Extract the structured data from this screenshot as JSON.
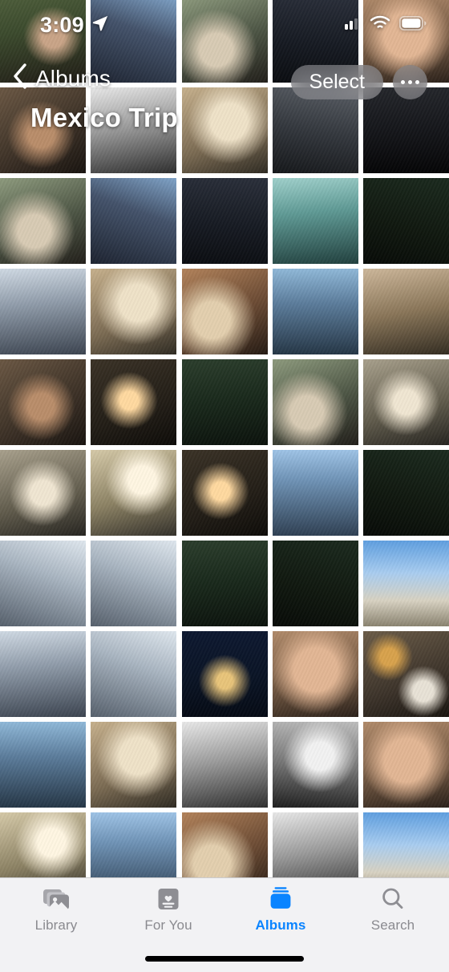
{
  "status_bar": {
    "time": "3:09",
    "location_icon": "location-arrow-icon",
    "cellular_icon": "cellular-signal-icon",
    "wifi_icon": "wifi-icon",
    "battery_icon": "battery-icon"
  },
  "nav": {
    "back_label": "Albums",
    "back_icon": "chevron-left-icon",
    "album_title": "Mexico Trip",
    "select_label": "Select",
    "more_icon": "ellipsis-icon"
  },
  "grid": {
    "columns": 5,
    "photos": [
      {
        "id": "photo-1",
        "style": "a"
      },
      {
        "id": "photo-2",
        "style": "b"
      },
      {
        "id": "photo-3",
        "style": "c"
      },
      {
        "id": "photo-4",
        "style": "d"
      },
      {
        "id": "photo-5",
        "style": "skin"
      },
      {
        "id": "photo-6",
        "style": "g"
      },
      {
        "id": "photo-7",
        "style": "gray"
      },
      {
        "id": "photo-8",
        "style": "e"
      },
      {
        "id": "photo-9",
        "style": "l"
      },
      {
        "id": "photo-10",
        "style": "dark"
      },
      {
        "id": "photo-11",
        "style": "c"
      },
      {
        "id": "photo-12",
        "style": "b"
      },
      {
        "id": "photo-13",
        "style": "d"
      },
      {
        "id": "photo-14",
        "style": "teal"
      },
      {
        "id": "photo-15",
        "style": "h"
      },
      {
        "id": "photo-16",
        "style": "f"
      },
      {
        "id": "photo-17",
        "style": "e"
      },
      {
        "id": "photo-18",
        "style": "k"
      },
      {
        "id": "photo-19",
        "style": "q"
      },
      {
        "id": "photo-20",
        "style": "r"
      },
      {
        "id": "photo-21",
        "style": "g"
      },
      {
        "id": "photo-22",
        "style": "p"
      },
      {
        "id": "photo-23",
        "style": "n"
      },
      {
        "id": "photo-24",
        "style": "c"
      },
      {
        "id": "photo-25",
        "style": "m"
      },
      {
        "id": "photo-26",
        "style": "m"
      },
      {
        "id": "photo-27",
        "style": "i"
      },
      {
        "id": "photo-28",
        "style": "p"
      },
      {
        "id": "photo-29",
        "style": "j"
      },
      {
        "id": "photo-30",
        "style": "h"
      },
      {
        "id": "photo-31",
        "style": "o"
      },
      {
        "id": "photo-32",
        "style": "o"
      },
      {
        "id": "photo-33",
        "style": "n"
      },
      {
        "id": "photo-34",
        "style": "h"
      },
      {
        "id": "photo-35",
        "style": "sky"
      },
      {
        "id": "photo-36",
        "style": "f"
      },
      {
        "id": "photo-37",
        "style": "o"
      },
      {
        "id": "photo-38",
        "style": "night"
      },
      {
        "id": "photo-39",
        "style": "skin"
      },
      {
        "id": "photo-40",
        "style": "food"
      },
      {
        "id": "photo-41",
        "style": "q"
      },
      {
        "id": "photo-42",
        "style": "e"
      },
      {
        "id": "photo-43",
        "style": "gray"
      },
      {
        "id": "photo-44",
        "style": "gray2"
      },
      {
        "id": "photo-45",
        "style": "skin"
      },
      {
        "id": "photo-46",
        "style": "i"
      },
      {
        "id": "photo-47",
        "style": "j"
      },
      {
        "id": "photo-48",
        "style": "k"
      },
      {
        "id": "photo-49",
        "style": "gray"
      },
      {
        "id": "photo-50",
        "style": "sky"
      }
    ]
  },
  "tab_bar": {
    "active_color": "#0a84ff",
    "inactive_color": "#8a8a8f",
    "tabs": [
      {
        "id": "library",
        "label": "Library",
        "icon": "photo-stack-icon",
        "active": false
      },
      {
        "id": "for-you",
        "label": "For You",
        "icon": "heart-card-icon",
        "active": false
      },
      {
        "id": "albums",
        "label": "Albums",
        "icon": "albums-stack-icon",
        "active": true
      },
      {
        "id": "search",
        "label": "Search",
        "icon": "magnifier-icon",
        "active": false
      }
    ]
  }
}
